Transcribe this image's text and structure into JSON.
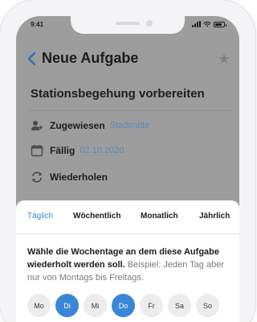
{
  "status_bar": {
    "time": "9:41"
  },
  "header": {
    "title": "Neue Aufgabe"
  },
  "task": {
    "title": "Stationsbegehung vorbereiten"
  },
  "details": {
    "assigned_label": "Zugewiesen",
    "assigned_value": "Stadtmitte",
    "due_label": "Fällig",
    "due_value": "02.10.2020",
    "repeat_label": "Wiederholen"
  },
  "tabs": [
    {
      "label": "Täglich",
      "active": true
    },
    {
      "label": "Wöchentlich",
      "active": false
    },
    {
      "label": "Monatlich",
      "active": false
    },
    {
      "label": "Jährlich",
      "active": false
    }
  ],
  "instruction": {
    "bold_text": "Wähle die Wochentage an dem diese Aufgabe wiederholt werden soll.",
    "hint_text": "Beispiel: Jeden Tag aber nur von Montags bis Freitags."
  },
  "weekdays": [
    {
      "label": "Mo",
      "selected": false
    },
    {
      "label": "Di",
      "selected": true
    },
    {
      "label": "Mi",
      "selected": false
    },
    {
      "label": "Do",
      "selected": true
    },
    {
      "label": "Fr",
      "selected": false
    },
    {
      "label": "Sa",
      "selected": false
    },
    {
      "label": "So",
      "selected": false
    }
  ],
  "colors": {
    "accent": "#3a86d6",
    "overlay_gray": "#9d9d9d",
    "link_blue": "#5b86b8"
  }
}
